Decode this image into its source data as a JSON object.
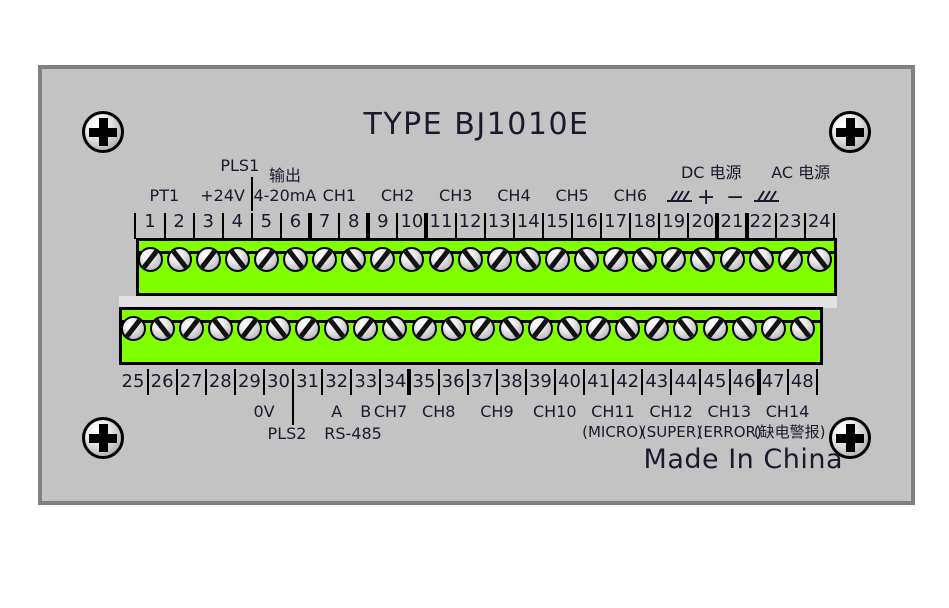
{
  "device": {
    "title": "TYPE BJ1010E",
    "origin_text": "Made In China",
    "panel_color": "#c3c3c3",
    "border_color": "#808080",
    "terminal_strip_color": "#80ff00"
  },
  "screws": {
    "corner": [
      {
        "name": "screw-top-left",
        "icon": "phillips-screw-icon"
      },
      {
        "name": "screw-top-right",
        "icon": "phillips-screw-icon"
      },
      {
        "name": "screw-bottom-left",
        "icon": "phillips-screw-icon"
      },
      {
        "name": "screw-bottom-right",
        "icon": "phillips-screw-icon"
      }
    ]
  },
  "top_row": {
    "numbers": [
      "1",
      "2",
      "3",
      "4",
      "5",
      "6",
      "7",
      "8",
      "9",
      "10",
      "11",
      "12",
      "13",
      "14",
      "15",
      "16",
      "17",
      "18",
      "19",
      "20",
      "21",
      "22",
      "23",
      "24"
    ],
    "group_boundaries_after": [
      6,
      8,
      10,
      20,
      21
    ],
    "labels": [
      {
        "text": "PT1",
        "terminals": [
          1,
          2
        ]
      },
      {
        "text": "+24V",
        "terminals": [
          3,
          4
        ]
      },
      {
        "text": "PLS1",
        "terminals": [
          4,
          5
        ],
        "leader": true
      },
      {
        "text": "输出",
        "terminals": [
          5,
          6
        ],
        "line2": "4-20mA"
      },
      {
        "text": "4-20mA",
        "terminals": [
          5,
          6
        ]
      },
      {
        "text": "CH1",
        "terminals": [
          7,
          8
        ]
      },
      {
        "text": "CH2",
        "terminals": [
          9,
          10
        ]
      },
      {
        "text": "CH3",
        "terminals": [
          11,
          12
        ]
      },
      {
        "text": "CH4",
        "terminals": [
          13,
          14
        ]
      },
      {
        "text": "CH5",
        "terminals": [
          15,
          16
        ]
      },
      {
        "text": "CH6",
        "terminals": [
          17,
          18
        ]
      },
      {
        "text": "DC 电源",
        "terminals": [
          19,
          20,
          21
        ]
      },
      {
        "text": "AC 电源",
        "terminals": [
          22,
          23,
          24
        ]
      }
    ],
    "symbols": [
      {
        "name": "dc-ground-symbol",
        "terminal": 19,
        "glyph": "ground-hatch-icon"
      },
      {
        "name": "dc-positive-symbol",
        "terminal": 20,
        "glyph": "+"
      },
      {
        "name": "dc-negative-symbol",
        "terminal": 21,
        "glyph": "−"
      },
      {
        "name": "ac-ground-symbol",
        "terminal": 22,
        "glyph": "ground-hatch-icon"
      }
    ]
  },
  "bottom_row": {
    "numbers": [
      "25",
      "26",
      "27",
      "28",
      "29",
      "30",
      "31",
      "32",
      "33",
      "34",
      "35",
      "36",
      "37",
      "38",
      "39",
      "40",
      "41",
      "42",
      "43",
      "44",
      "45",
      "46",
      "47",
      "48"
    ],
    "group_boundaries_after": [
      34,
      46
    ],
    "labels": [
      {
        "text": "0V",
        "terminals": [
          29,
          30
        ]
      },
      {
        "text": "PLS2",
        "terminals": [
          30,
          31
        ],
        "leader": true
      },
      {
        "text": "A",
        "terminals": [
          32
        ]
      },
      {
        "text": "B",
        "terminals": [
          33
        ]
      },
      {
        "text": "RS-485",
        "terminals": [
          32,
          33
        ]
      },
      {
        "text": "CH7",
        "terminals": [
          33,
          34
        ]
      },
      {
        "text": "CH8",
        "terminals": [
          35,
          36
        ]
      },
      {
        "text": "CH9",
        "terminals": [
          37,
          38
        ]
      },
      {
        "text": "CH10",
        "terminals": [
          39,
          40
        ]
      },
      {
        "text": "CH11",
        "terminals": [
          41,
          42
        ],
        "sub": "(MICRO)"
      },
      {
        "text": "CH12",
        "terminals": [
          43,
          44
        ],
        "sub": "(SUPER)"
      },
      {
        "text": "CH13",
        "terminals": [
          45,
          46
        ],
        "sub": "(ERROR)"
      },
      {
        "text": "CH14",
        "terminals": [
          47,
          48
        ],
        "sub": "(缺电警报)"
      }
    ]
  },
  "annotations": {
    "pt1": "PT1",
    "v24": "+24V",
    "pls1": "PLS1",
    "output_cn": "输出",
    "output_range": "4-20mA",
    "ch1": "CH1",
    "ch2": "CH2",
    "ch3": "CH3",
    "ch4": "CH4",
    "ch5": "CH5",
    "ch6": "CH6",
    "dc_power": "DC 电源",
    "ac_power": "AC 电源",
    "plus": "+",
    "minus": "−",
    "zero_v": "0V",
    "pls2": "PLS2",
    "rs485_a": "A",
    "rs485_b": "B",
    "rs485": "RS-485",
    "ch7": "CH7",
    "ch8": "CH8",
    "ch9": "CH9",
    "ch10": "CH10",
    "ch11": "CH11",
    "ch11_sub": "(MICRO)",
    "ch12": "CH12",
    "ch12_sub": "(SUPER)",
    "ch13": "CH13",
    "ch13_sub": "(ERROR)",
    "ch14": "CH14",
    "ch14_sub": "(缺电警报)"
  }
}
